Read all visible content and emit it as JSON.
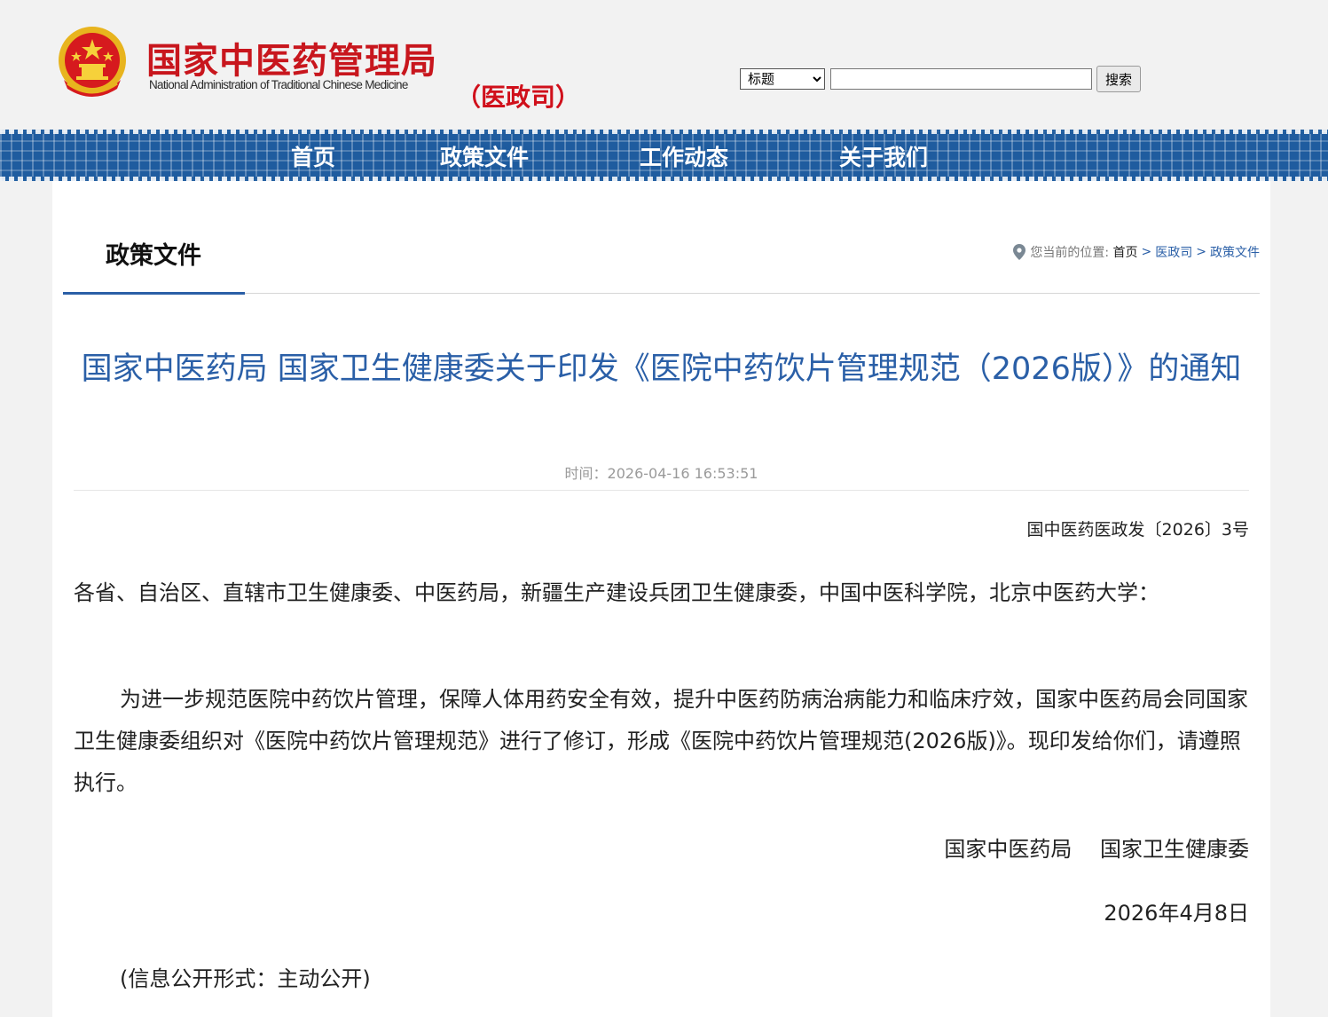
{
  "header": {
    "org_name_cn": "国家中医药管理局",
    "org_name_en": "National Administration of Traditional Chinese Medicine",
    "department": "（医政司）",
    "search": {
      "type_selected": "标题",
      "input_value": "",
      "button_label": "搜索"
    }
  },
  "nav": {
    "items": [
      {
        "label": "首页"
      },
      {
        "label": "政策文件"
      },
      {
        "label": "工作动态"
      },
      {
        "label": "关于我们"
      }
    ]
  },
  "section": {
    "title": "政策文件",
    "breadcrumb": {
      "prefix": "您当前的位置:",
      "home": "首页",
      "level1": "医政司",
      "level2": "政策文件",
      "separator": ">"
    }
  },
  "article": {
    "title": "国家中医药局 国家卫生健康委关于印发《医院中药饮片管理规范（2026版）》的通知",
    "time": "时间：2026-04-16 16:53:51",
    "doc_number": "国中医药医政发〔2026〕3号",
    "addressee": "各省、自治区、直辖市卫生健康委、中医药局，新疆生产建设兵团卫生健康委，中国中医科学院，北京中医药大学：",
    "body": "为进一步规范医院中药饮片管理，保障人体用药安全有效，提升中医药防病治病能力和临床疗效，国家中医药局会同国家卫生健康委组织对《医院中药饮片管理规范》进行了修订，形成《医院中药饮片管理规范(2026版)》。现印发给你们，请遵照执行。",
    "signatories": "国家中医药局　 国家卫生健康委",
    "date": "2026年4月8日",
    "disclosure": "(信息公开形式：主动公开)"
  },
  "colors": {
    "brand_red": "#c8161d",
    "nav_blue": "#1f5c9f",
    "title_blue": "#2a5fa7"
  },
  "icons": {
    "emblem": "national-emblem-icon",
    "location": "location-pin-icon"
  }
}
